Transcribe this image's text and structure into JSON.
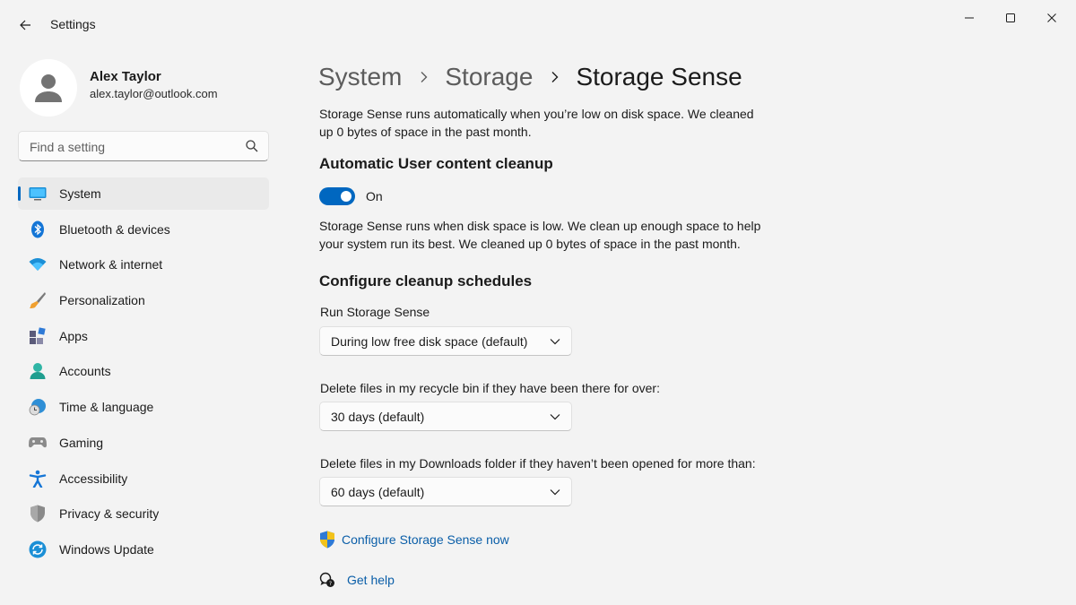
{
  "app": {
    "title": "Settings"
  },
  "profile": {
    "name": "Alex Taylor",
    "email": "alex.taylor@outlook.com"
  },
  "search": {
    "placeholder": "Find a setting"
  },
  "sidebar": {
    "items": [
      {
        "label": "System",
        "icon": "system-icon",
        "active": true
      },
      {
        "label": "Bluetooth & devices",
        "icon": "bluetooth-icon"
      },
      {
        "label": "Network & internet",
        "icon": "wifi-icon"
      },
      {
        "label": "Personalization",
        "icon": "brush-icon"
      },
      {
        "label": "Apps",
        "icon": "apps-icon"
      },
      {
        "label": "Accounts",
        "icon": "person-icon"
      },
      {
        "label": "Time & language",
        "icon": "globe-clock-icon"
      },
      {
        "label": "Gaming",
        "icon": "gamepad-icon"
      },
      {
        "label": "Accessibility",
        "icon": "accessibility-icon"
      },
      {
        "label": "Privacy & security",
        "icon": "shield-icon"
      },
      {
        "label": "Windows Update",
        "icon": "update-icon"
      }
    ]
  },
  "breadcrumb": {
    "items": [
      "System",
      "Storage",
      "Storage Sense"
    ]
  },
  "main": {
    "intro": "Storage Sense runs automatically when you’re low on disk space. We cleaned up 0 bytes of space in the past month.",
    "cleanup_section": {
      "title": "Automatic User content cleanup",
      "toggle_state": "On",
      "description": "Storage Sense runs when disk space is low. We clean up enough space to help your system run its best. We cleaned up 0 bytes of space in the past month."
    },
    "schedules_section": {
      "title": "Configure cleanup schedules",
      "fields": [
        {
          "label": "Run Storage Sense",
          "value": "During low free disk space (default)"
        },
        {
          "label": "Delete files in my recycle bin if they have been there for over:",
          "value": "30 days (default)"
        },
        {
          "label": "Delete files in my Downloads folder if they haven’t been opened for more than:",
          "value": "60 days (default)"
        }
      ]
    },
    "links": {
      "configure": "Configure Storage Sense now",
      "help": "Get help"
    }
  },
  "colors": {
    "accent": "#0067c0",
    "link": "#0a5ea8",
    "background": "#f3f3f3"
  }
}
